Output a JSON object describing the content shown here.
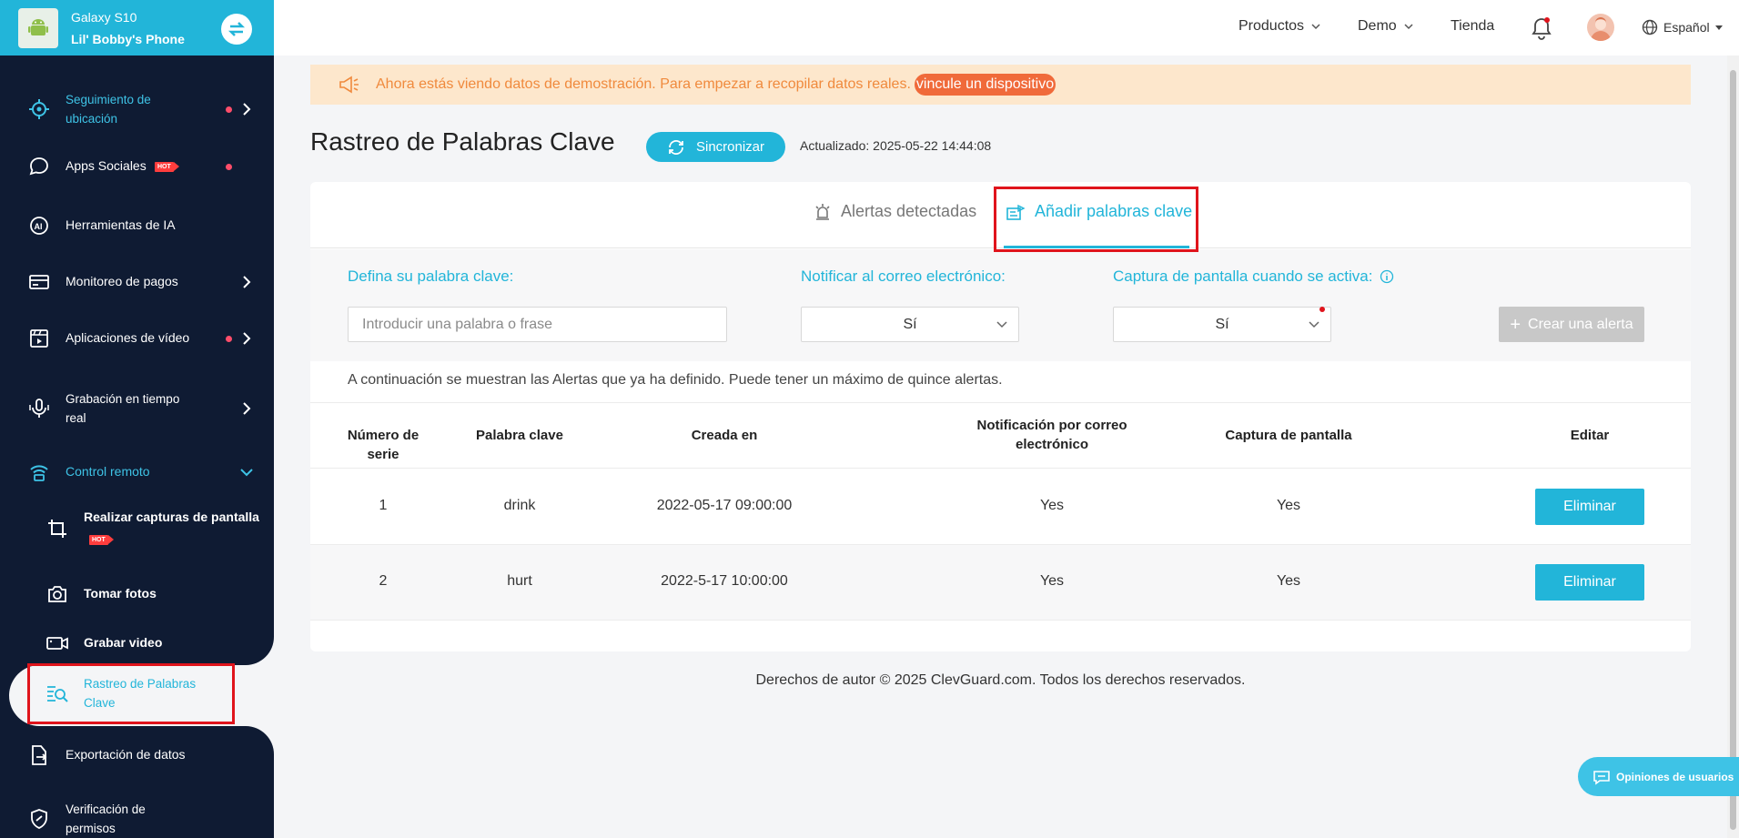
{
  "device": {
    "model": "Galaxy S10",
    "name": "Lil' Bobby's Phone"
  },
  "sidebar": {
    "items": [
      {
        "label": "Seguimiento de ubicación",
        "icon": "location-target-icon",
        "dot": true,
        "chevron": true
      },
      {
        "label": "Apps Sociales",
        "icon": "chat-bubble-icon",
        "badge": "HOT",
        "dot": true
      },
      {
        "label": "Herramientas de IA",
        "icon": "ai-icon"
      },
      {
        "label": "Monitoreo de pagos",
        "icon": "card-icon",
        "chevron": true
      },
      {
        "label": "Aplicaciones de vídeo",
        "icon": "video-app-icon",
        "dot": true,
        "chevron": true
      },
      {
        "label": "Grabación en tiempo real",
        "icon": "microphone-icon",
        "chevron": true
      },
      {
        "label": "Control remoto",
        "icon": "wifi-remote-icon",
        "chevron": "down"
      },
      {
        "label": "Realizar capturas de pantalla",
        "icon": "crop-icon",
        "badge": "HOT"
      },
      {
        "label": "Tomar fotos",
        "icon": "camera-icon"
      },
      {
        "label": "Grabar video",
        "icon": "video-camera-icon"
      },
      {
        "label": "Rastreo de Palabras Clave",
        "icon": "keyword-search-icon",
        "active": true
      },
      {
        "label": "Exportación de datos",
        "icon": "export-icon"
      },
      {
        "label": "Verificación de permisos",
        "icon": "shield-icon"
      }
    ]
  },
  "header": {
    "menu": [
      "Productos",
      "Demo",
      "Tienda"
    ],
    "language": "Español"
  },
  "banner": {
    "text": "Ahora estás viendo datos de demostración. Para empezar a recopilar datos reales.",
    "link": "vincule un dispositivo"
  },
  "page": {
    "title": "Rastreo de Palabras Clave",
    "sync_label": "Sincronizar",
    "updated": "Actualizado: 2025-05-22 14:44:08"
  },
  "tabs": [
    {
      "label": "Alertas detectadas",
      "icon": "alarm-icon",
      "active": false
    },
    {
      "label": "Añadir palabras clave",
      "icon": "add-keyword-icon",
      "active": true
    }
  ],
  "form": {
    "keyword_label": "Defina su palabra clave:",
    "keyword_placeholder": "Introducir una palabra o frase",
    "email_label": "Notificar al correo electrónico:",
    "email_value": "Sí",
    "screenshot_label": "Captura de pantalla cuando se activa:",
    "screenshot_value": "Sí",
    "create_label": "Crear una alerta"
  },
  "note": "A continuación se muestran las Alertas que ya ha definido. Puede tener un máximo de quince alertas.",
  "table": {
    "headers": [
      "Número de serie",
      "Palabra clave",
      "Creada en",
      "Notificación por correo electrónico",
      "Captura de pantalla",
      "Editar"
    ],
    "rows": [
      [
        "1",
        "drink",
        "2022-05-17 09:00:00",
        "Yes",
        "Yes",
        "Eliminar"
      ],
      [
        "2",
        "hurt",
        "2022-5-17 10:00:00",
        "Yes",
        "Yes",
        "Eliminar"
      ]
    ]
  },
  "footer": "Derechos de autor © 2025 ClevGuard.com. Todos los derechos reservados.",
  "feedback_label": "Opiniones de usuarios",
  "colors": {
    "accent": "#22b5d9",
    "sidebar": "#0f1b33",
    "banner_bg": "#fde7cc",
    "banner_text": "#f08a3d",
    "highlight": "#e0141c"
  }
}
